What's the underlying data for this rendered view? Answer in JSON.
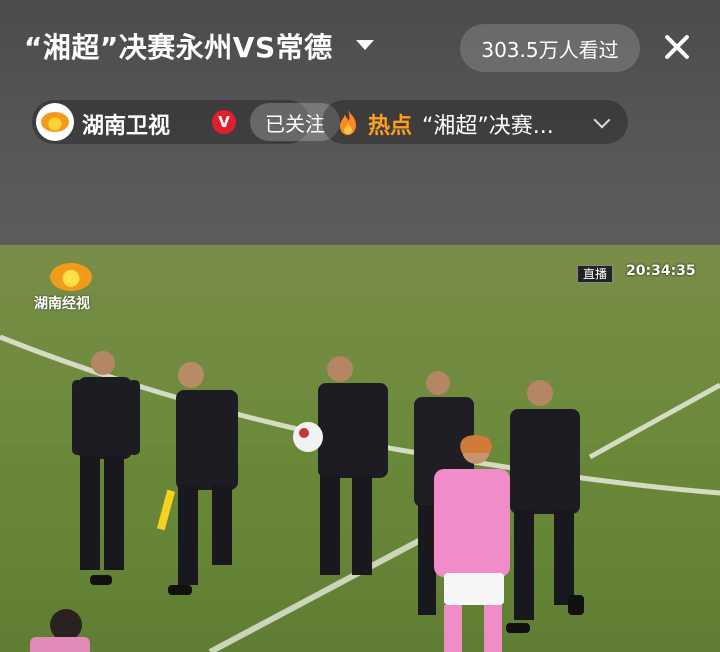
{
  "header": {
    "title": "“湘超”决赛永州VS常德",
    "views": "303.5万人看过"
  },
  "channel": {
    "name": "湖南卫视",
    "verified": "V",
    "follow_label": "已关注"
  },
  "hot": {
    "label": "热点",
    "text": "“湘超”决赛..."
  },
  "video": {
    "broadcaster": "湖南经视",
    "live_label": "直播",
    "time": "20:34:35"
  },
  "colors": {
    "accent_orange": "#ff9f1c",
    "verified_red": "#e01e2d",
    "pitch_green": "#6e8a3c",
    "player_pink": "#f08cc8"
  }
}
